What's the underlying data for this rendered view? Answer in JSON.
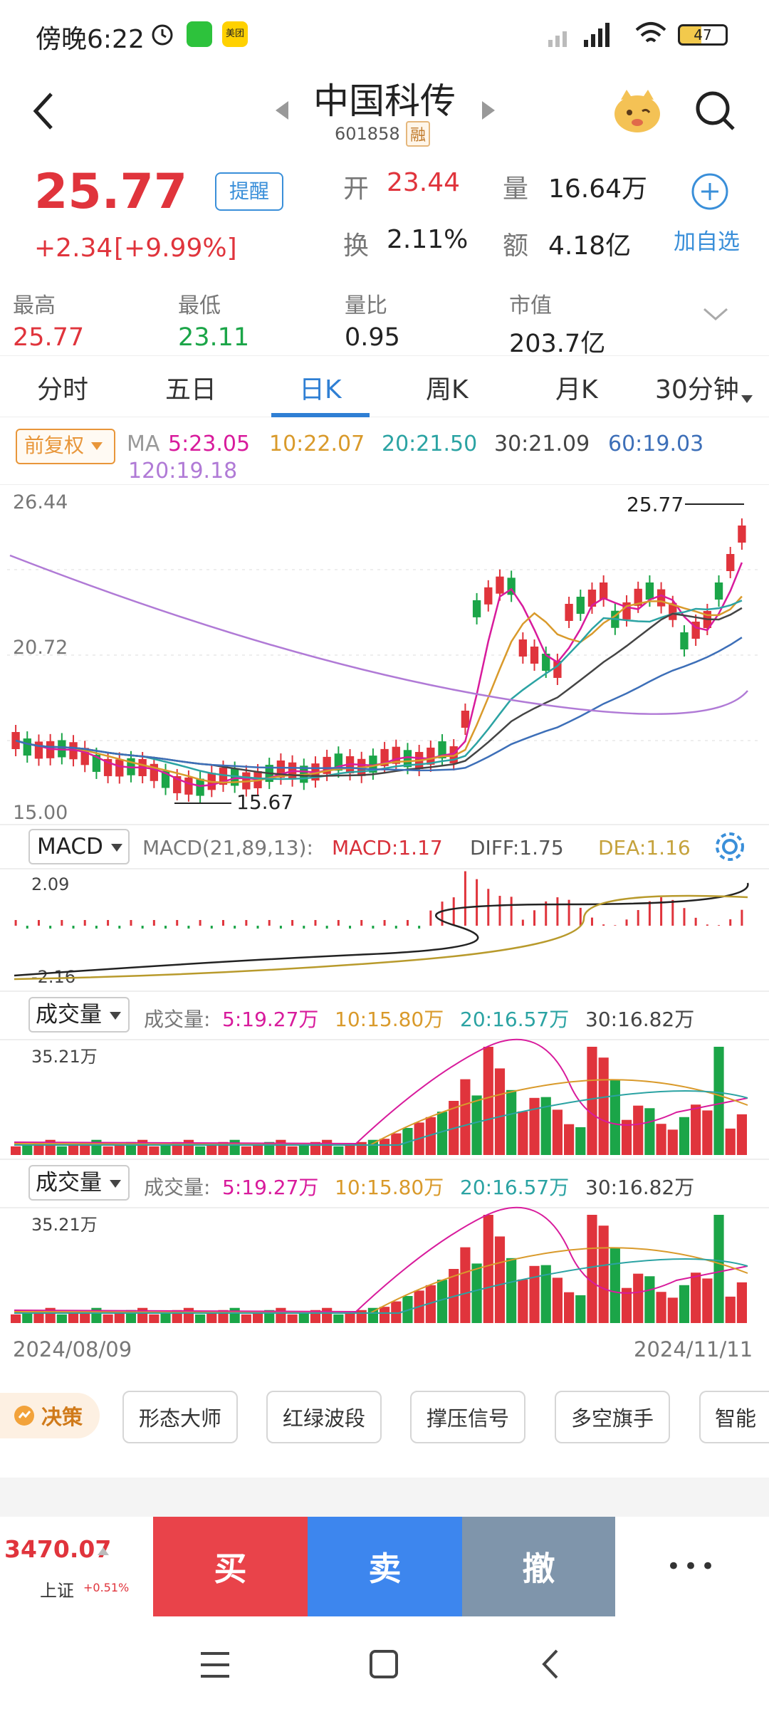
{
  "status_bar": {
    "time": "傍晚6:22",
    "battery": "47",
    "app1": "微信",
    "app2": "美团"
  },
  "header": {
    "title": "中国科传",
    "code": "601858",
    "badge": "融"
  },
  "quote": {
    "price": "25.77",
    "change": "+2.34",
    "change_pct": "[+9.99%]",
    "alert_btn": "提醒",
    "open_label": "开",
    "open_value": "23.44",
    "volume_label": "量",
    "volume_value": "16.64万",
    "turnover_label": "换",
    "turnover_value": "2.11%",
    "amount_label": "额",
    "amount_value": "4.18亿",
    "add_watch": "加自选"
  },
  "stats": [
    {
      "label": "最高",
      "value": "25.77",
      "color": "red"
    },
    {
      "label": "最低",
      "value": "23.11",
      "color": "green"
    },
    {
      "label": "量比",
      "value": "0.95",
      "color": "dark"
    },
    {
      "label": "市值",
      "value": "203.7亿",
      "color": "dark"
    }
  ],
  "tabs": [
    {
      "label": "分时",
      "active": false
    },
    {
      "label": "五日",
      "active": false
    },
    {
      "label": "日K",
      "active": true
    },
    {
      "label": "周K",
      "active": false
    },
    {
      "label": "月K",
      "active": false
    },
    {
      "label": "30分钟",
      "active": false
    }
  ],
  "ma": {
    "adjust": "前复权",
    "prefix": "MA",
    "ma5": "5:23.05",
    "ma10": "10:22.07",
    "ma20": "20:21.50",
    "ma30": "30:21.09",
    "ma60": "60:19.03",
    "ma120": "120:19.18",
    "colors": {
      "ma5": "#d81b9c",
      "ma10": "#d99a2b",
      "ma20": "#2ba3a3",
      "ma30": "#444444",
      "ma60": "#3d6fb8",
      "ma120": "#b07ad6"
    }
  },
  "kline": {
    "high_label": "26.44",
    "mid_label": "20.72",
    "low_label": "15.00",
    "max_mark": "25.77",
    "min_mark": "15.67"
  },
  "macd": {
    "name": "MACD",
    "params": "MACD(21,89,13):",
    "macd": "MACD:1.17",
    "diff": "DIFF:1.75",
    "dea": "DEA:1.16",
    "top_label": "2.09",
    "bottom_label": "-2.16"
  },
  "volume1": {
    "name": "成交量",
    "prefix": "成交量:",
    "v5": "5:19.27万",
    "v10": "10:15.80万",
    "v20": "20:16.57万",
    "v30": "30:16.82万",
    "top_label": "35.21万"
  },
  "volume2": {
    "name": "成交量",
    "prefix": "成交量:",
    "v5": "5:19.27万",
    "v10": "10:15.80万",
    "v20": "20:16.57万",
    "v30": "30:16.82万",
    "top_label": "35.21万"
  },
  "dates": {
    "start": "2024/08/09",
    "end": "2024/11/11"
  },
  "strategy": {
    "label": "决策",
    "chips": [
      "形态大师",
      "红绿波段",
      "撑压信号",
      "多空旗手",
      "智能"
    ]
  },
  "bottom": {
    "index_value": "3470.07",
    "index_name": "上证",
    "index_change": "+0.51%",
    "buy": "买",
    "sell": "卖",
    "cancel": "撤",
    "more": "•••"
  }
}
